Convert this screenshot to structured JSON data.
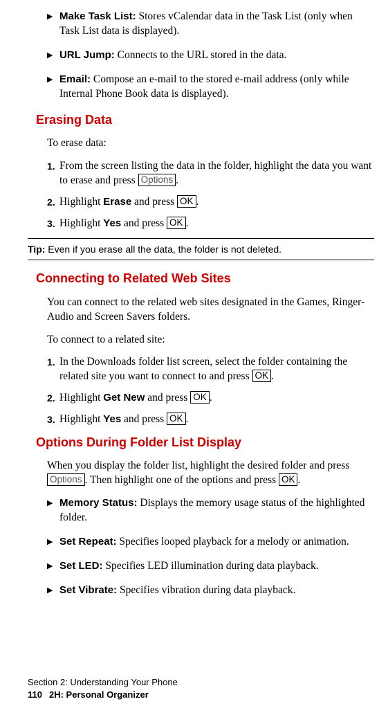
{
  "bullets_top": [
    {
      "label": "Make Task List:",
      "text": " Stores vCalendar data in the Task List (only when Task List data is displayed)."
    },
    {
      "label": "URL Jump:",
      "text": " Connects to the URL stored in the data."
    },
    {
      "label": "Email:",
      "text": " Compose an e-mail to the stored e-mail address (only while Internal Phone Book data is displayed)."
    }
  ],
  "erasing": {
    "heading": "Erasing Data",
    "intro": "To erase data:",
    "steps": [
      {
        "num": "1.",
        "pre": "From the screen listing the data in the folder, highlight the data you want to erase and press ",
        "btn": "Options",
        "post": "."
      },
      {
        "num": "2.",
        "pre": "Highlight ",
        "bold": "Erase",
        "mid": " and press ",
        "btn": "OK",
        "post": "."
      },
      {
        "num": "3.",
        "pre": "Highlight ",
        "bold": "Yes",
        "mid": " and press ",
        "btn": "OK",
        "post": "."
      }
    ]
  },
  "tip": {
    "label": "Tip:",
    "text": " Even if you erase all the data, the folder is not deleted."
  },
  "connecting": {
    "heading": "Connecting to Related Web Sites",
    "intro1": "You can connect to the related web sites designated in the Games, Ringer-Audio and Screen Savers folders.",
    "intro2": "To connect to a related site:",
    "steps": [
      {
        "num": "1.",
        "pre": "In the Downloads folder list screen, select the folder containing the related site you want to connect to and press ",
        "btn": "OK",
        "post": "."
      },
      {
        "num": "2.",
        "pre": "Highlight ",
        "bold": "Get New",
        "mid": " and press ",
        "btn": "OK",
        "post": "."
      },
      {
        "num": "3.",
        "pre": "Highlight ",
        "bold": "Yes",
        "mid": " and press ",
        "btn": "OK",
        "post": "."
      }
    ]
  },
  "options": {
    "heading": "Options During Folder List Display",
    "intro_pre": "When you display the folder list, highlight the desired folder and press ",
    "intro_btn1": "Options",
    "intro_mid": ". Then highlight one of the options and press ",
    "intro_btn2": "OK",
    "intro_post": ".",
    "bullets": [
      {
        "label": "Memory Status:",
        "text": " Displays the memory usage status of the highlighted folder."
      },
      {
        "label": "Set Repeat:",
        "text": " Specifies looped playback for a melody or animation."
      },
      {
        "label": "Set LED:",
        "text": " Specifies LED illumination during data playback."
      },
      {
        "label": "Set Vibrate:",
        "text": " Specifies vibration during data playback."
      }
    ]
  },
  "footer": {
    "section": "Section 2: Understanding Your Phone",
    "page": "110",
    "title": "2H: Personal Organizer"
  },
  "marks": {
    "triangle": "▶"
  }
}
